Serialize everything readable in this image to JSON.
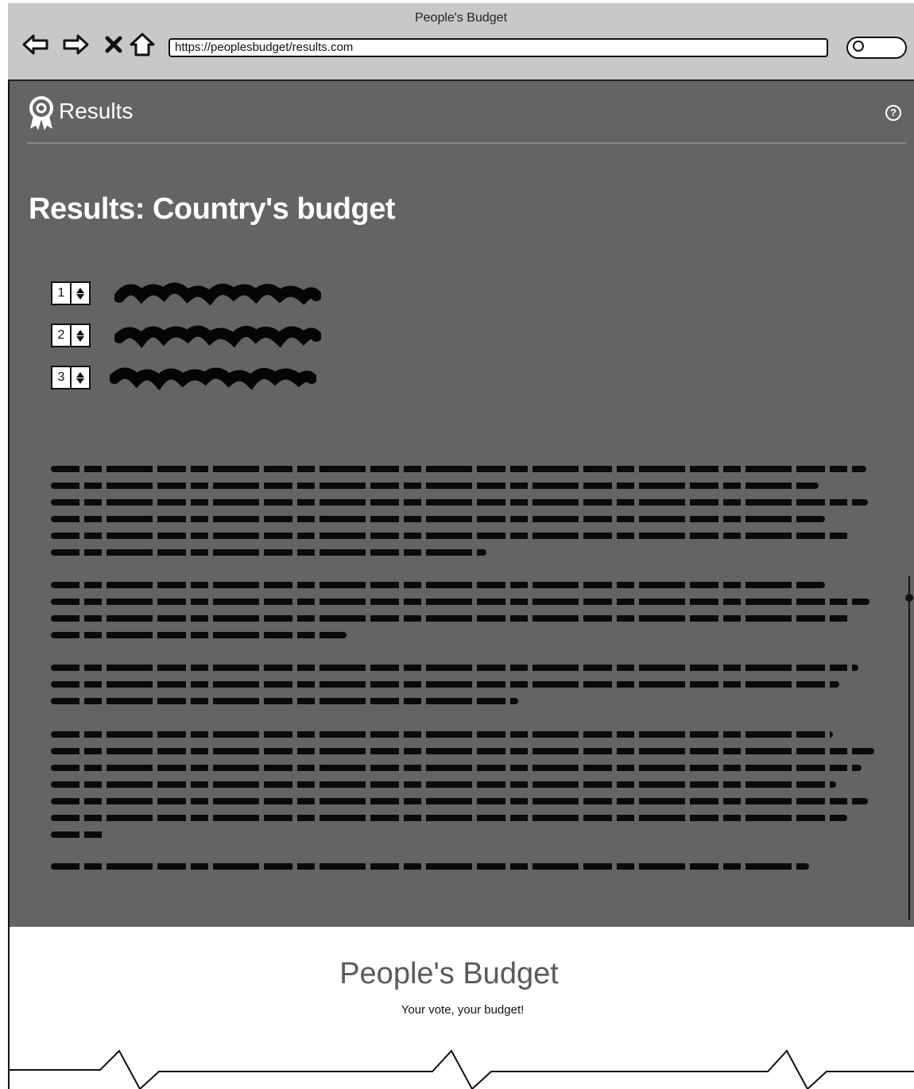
{
  "browser": {
    "window_title": "People's Budget",
    "url": "https://peoplesbudget/results.com"
  },
  "header": {
    "title": "Results",
    "help_label": "?"
  },
  "main": {
    "page_title": "Results: Country's budget",
    "ranking": [
      {
        "rank": "1"
      },
      {
        "rank": "2"
      },
      {
        "rank": "3"
      }
    ]
  },
  "footer": {
    "title": "People's Budget",
    "tagline": "Your vote, your budget!"
  },
  "icons": {
    "back": "back-arrow-icon",
    "forward": "forward-arrow-icon",
    "stop": "stop-icon",
    "home": "home-icon",
    "search": "search-icon",
    "award": "award-icon",
    "help": "help-icon"
  },
  "colors": {
    "chrome": "#c8c8c8",
    "app_background": "#646464",
    "page_background": "#ffffff",
    "text_on_dark": "#ffffff"
  }
}
